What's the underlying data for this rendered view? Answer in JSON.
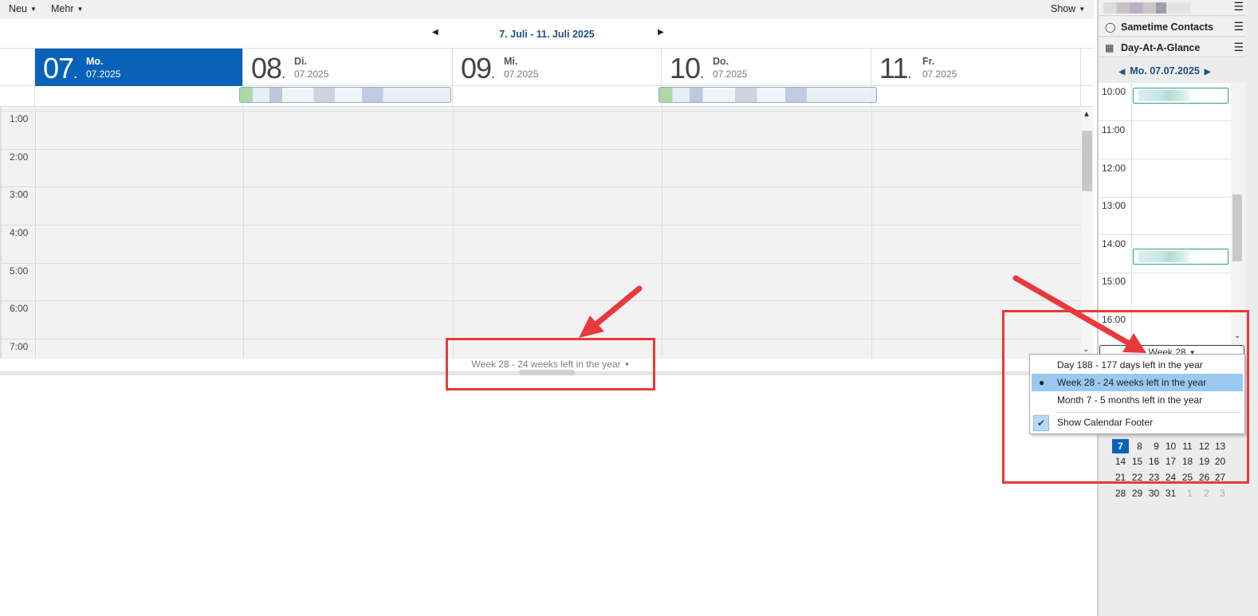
{
  "toolbar": {
    "new_label": "Neu",
    "more_label": "Mehr",
    "show_label": "Show"
  },
  "range": {
    "title": "7. Juli - 11. Juli 2025"
  },
  "days": [
    {
      "num": "07",
      "name": "Mo.",
      "date": "07.2025",
      "today": true
    },
    {
      "num": "08",
      "name": "Di.",
      "date": "07.2025",
      "today": false
    },
    {
      "num": "09",
      "name": "Mi.",
      "date": "07.2025",
      "today": false
    },
    {
      "num": "10",
      "name": "Do.",
      "date": "07.2025",
      "today": false
    },
    {
      "num": "11",
      "name": "Fr.",
      "date": "07.2025",
      "today": false
    }
  ],
  "time_slots": [
    "1:00",
    "2:00",
    "3:00",
    "4:00",
    "5:00",
    "6:00",
    "7:00"
  ],
  "footer": {
    "text": "Week 28 - 24 weeks left in the year"
  },
  "sidebar": {
    "sametime_title": "Sametime Contacts",
    "dag_title": "Day-At-A-Glance",
    "dag_date": "Mo. 07.07.2025",
    "dag_times": [
      "10:00",
      "11:00",
      "12:00",
      "13:00",
      "14:00",
      "15:00",
      "16:00"
    ],
    "week_label": "Week 28"
  },
  "popup_menu": {
    "items": [
      {
        "label": "Day 188 - 177 days left in the year",
        "selected": false
      },
      {
        "label": "Week 28 - 24 weeks left in the year",
        "selected": true
      },
      {
        "label": "Month 7 - 5 months left in the year",
        "selected": false
      }
    ],
    "show_footer_label": "Show Calendar Footer",
    "show_footer_checked": true
  },
  "mini_calendar": {
    "rows": [
      [
        "7",
        "8",
        "9",
        "10",
        "11",
        "12",
        "13"
      ],
      [
        "14",
        "15",
        "16",
        "17",
        "18",
        "19",
        "20"
      ],
      [
        "21",
        "22",
        "23",
        "24",
        "25",
        "26",
        "27"
      ],
      [
        "28",
        "29",
        "30",
        "31",
        "1",
        "2",
        "3"
      ]
    ],
    "selected": "7"
  },
  "colors": {
    "accent": "#0a62b8",
    "annotation_red": "#e8393b",
    "menu_highlight": "#99c9f0"
  }
}
